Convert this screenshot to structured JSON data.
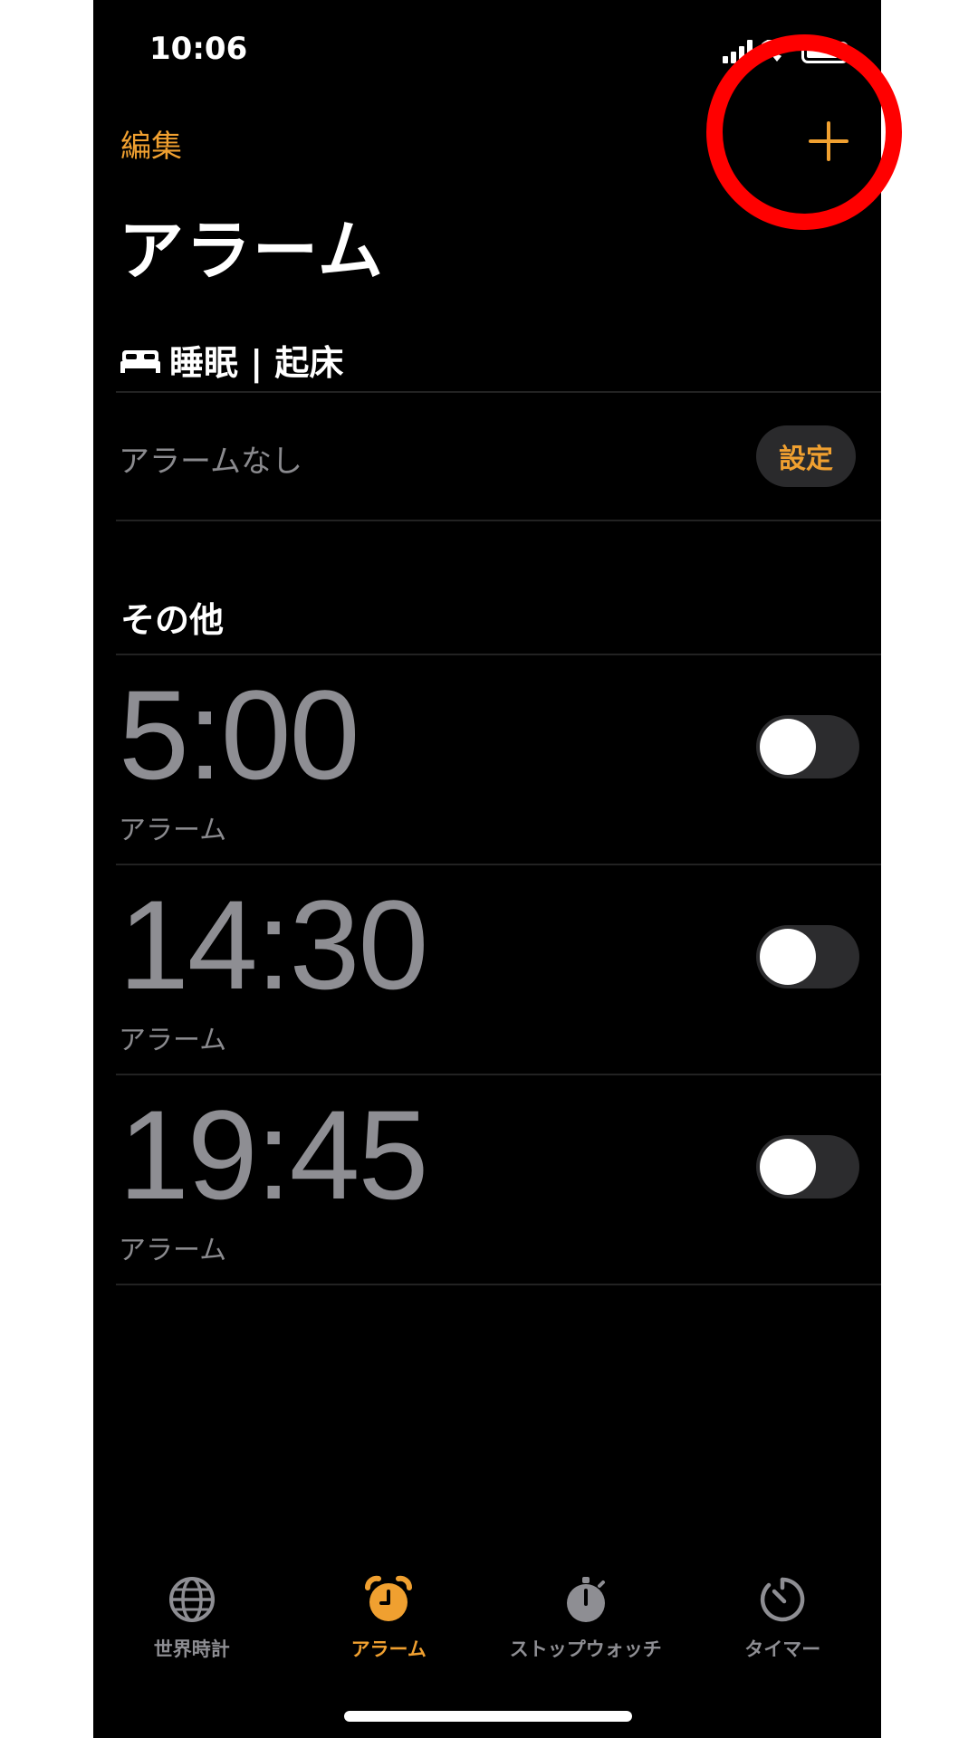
{
  "status_bar": {
    "time": "10:06"
  },
  "nav": {
    "edit_label": "編集",
    "title": "アラーム"
  },
  "sleep": {
    "header": "睡眠 | 起床",
    "no_alarm_text": "アラームなし",
    "set_label": "設定"
  },
  "other": {
    "header": "その他",
    "alarms": [
      {
        "time": "5:00",
        "label": "アラーム",
        "enabled": false
      },
      {
        "time": "14:30",
        "label": "アラーム",
        "enabled": false
      },
      {
        "time": "19:45",
        "label": "アラーム",
        "enabled": false
      }
    ]
  },
  "tabs": [
    {
      "label": "世界時計",
      "icon": "globe-icon",
      "active": false
    },
    {
      "label": "アラーム",
      "icon": "alarm-clock-icon",
      "active": true
    },
    {
      "label": "ストップウォッチ",
      "icon": "stopwatch-icon",
      "active": false
    },
    {
      "label": "タイマー",
      "icon": "timer-icon",
      "active": false
    }
  ],
  "colors": {
    "accent": "#f0a030",
    "background": "#000000",
    "annotation": "#ff0000"
  }
}
